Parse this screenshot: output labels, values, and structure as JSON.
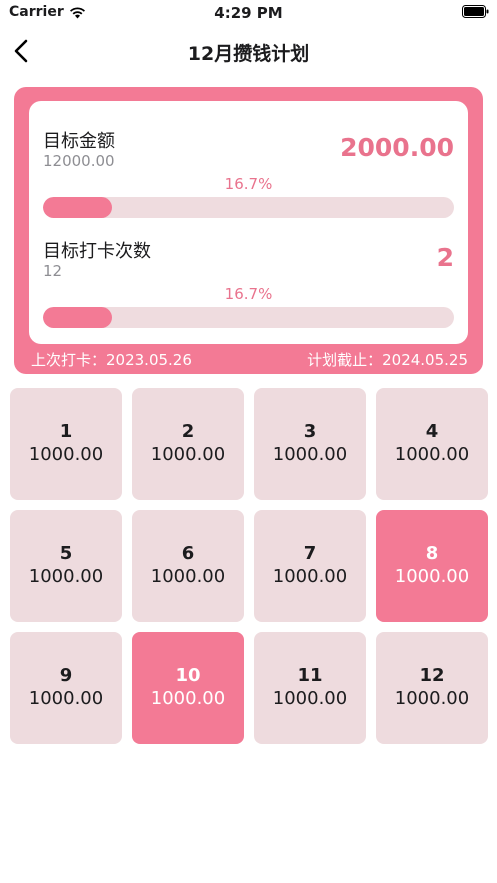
{
  "status_bar": {
    "carrier": "Carrier",
    "time": "4:29 PM"
  },
  "nav": {
    "title": "12月攒钱计划",
    "back_icon": "chevron-left-icon"
  },
  "summary": {
    "goals": [
      {
        "label": "目标金额",
        "sub": "12000.00",
        "value": "2000.00",
        "percent_text": "16.7%",
        "progress": 0.167
      },
      {
        "label": "目标打卡次数",
        "sub": "12",
        "value": "2",
        "percent_text": "16.7%",
        "progress": 0.167
      }
    ],
    "last_checkin": "上次打卡：2023.05.26",
    "plan_deadline": "计划截止：2024.05.25"
  },
  "cells": [
    {
      "index": "1",
      "amount": "1000.00",
      "done": false
    },
    {
      "index": "2",
      "amount": "1000.00",
      "done": false
    },
    {
      "index": "3",
      "amount": "1000.00",
      "done": false
    },
    {
      "index": "4",
      "amount": "1000.00",
      "done": false
    },
    {
      "index": "5",
      "amount": "1000.00",
      "done": false
    },
    {
      "index": "6",
      "amount": "1000.00",
      "done": false
    },
    {
      "index": "7",
      "amount": "1000.00",
      "done": false
    },
    {
      "index": "8",
      "amount": "1000.00",
      "done": true
    },
    {
      "index": "9",
      "amount": "1000.00",
      "done": false
    },
    {
      "index": "10",
      "amount": "1000.00",
      "done": true
    },
    {
      "index": "11",
      "amount": "1000.00",
      "done": false
    },
    {
      "index": "12",
      "amount": "1000.00",
      "done": false
    }
  ],
  "colors": {
    "accent": "#f37a95",
    "accent_text": "#e9738d",
    "cell_bg": "#eedbde",
    "track_bg": "#efdcdf"
  }
}
